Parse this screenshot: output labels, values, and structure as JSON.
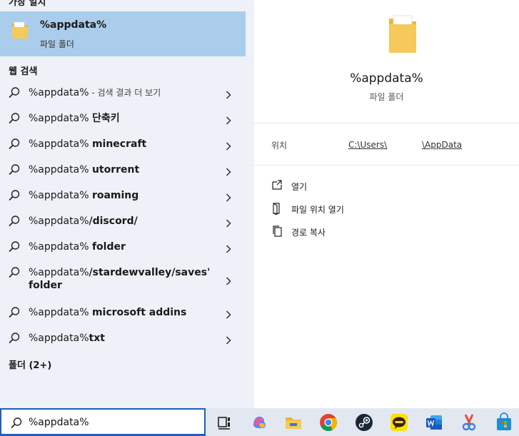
{
  "best_match": {
    "section_title": "가장 일치",
    "name": "%appdata%",
    "type": "파일 폴더"
  },
  "web": {
    "section_title": "웹 검색",
    "results": [
      {
        "query": "%appdata%",
        "suffix": "",
        "desc": " - 검색 결과 더 보기"
      },
      {
        "query": "%appdata% ",
        "suffix": "단축키",
        "desc": ""
      },
      {
        "query": "%appdata% ",
        "suffix": "minecraft",
        "desc": ""
      },
      {
        "query": "%appdata% ",
        "suffix": "utorrent",
        "desc": ""
      },
      {
        "query": "%appdata% ",
        "suffix": "roaming",
        "desc": ""
      },
      {
        "query": "%appdata%",
        "suffix": "/discord/",
        "desc": ""
      },
      {
        "query": "%appdata% ",
        "suffix": "folder",
        "desc": ""
      },
      {
        "query": "%appdata%",
        "suffix": "/stardewvalley/saves' folder",
        "desc": ""
      },
      {
        "query": "%appdata% ",
        "suffix": "microsoft addins",
        "desc": ""
      },
      {
        "query": "%appdata%",
        "suffix": "txt",
        "desc": ""
      }
    ]
  },
  "folders": {
    "section_title": "폴더 (2+)"
  },
  "preview": {
    "name": "%appdata%",
    "type": "파일 폴더",
    "location_label": "위치",
    "location_part1": "C:\\Users\\",
    "location_part2": "\\AppData",
    "actions": {
      "open": "열기",
      "open_location": "파일 위치 열기",
      "copy_path": "경로 복사"
    }
  },
  "taskbar": {
    "search_value": "%appdata%"
  },
  "colors": {
    "selected": "#a9cdea",
    "accent": "#1f5fb8",
    "folder": "#f5c95a"
  }
}
